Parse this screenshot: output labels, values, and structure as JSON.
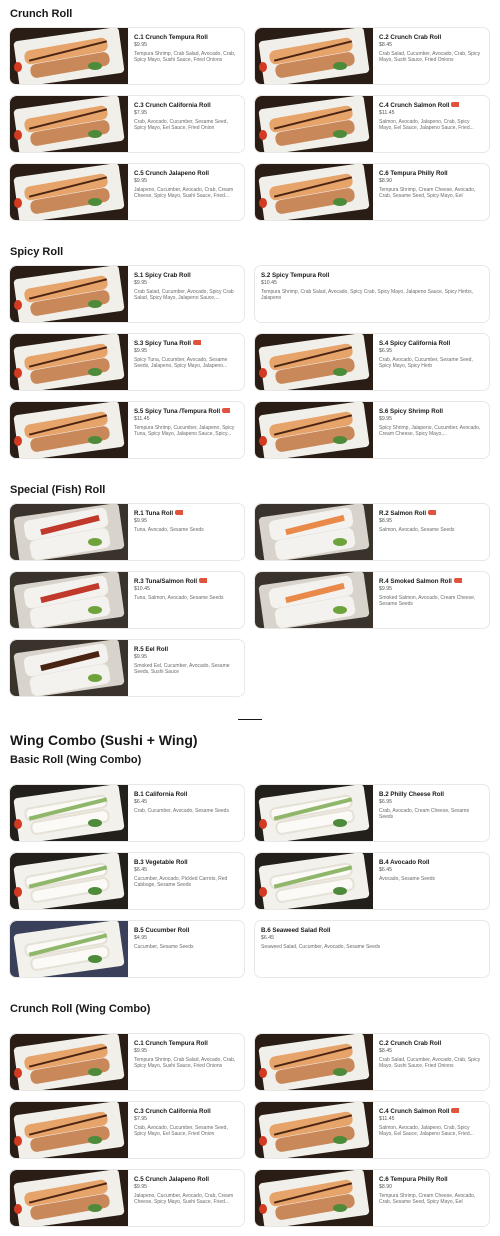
{
  "sections": {
    "crunch": {
      "title": "Crunch Roll"
    },
    "spicy": {
      "title": "Spicy Roll"
    },
    "special": {
      "title": "Special (Fish) Roll"
    },
    "wing": {
      "title": "Wing Combo (Sushi + Wing)"
    },
    "basic_wing": {
      "title": "Basic Roll (Wing Combo)"
    },
    "crunch_wing": {
      "title": "Crunch Roll (Wing Combo)"
    }
  },
  "items": [
    {
      "name": "C.1 Crunch Tempura Roll",
      "price": "$9.95",
      "desc": "Tempura Shrimp, Crab Salad, Avocado, Crab, Spicy Mayo, Sushi Sauce, Fried Onions"
    },
    {
      "name": "C.2 Crunch Crab Roll",
      "price": "$8.45",
      "desc": "Crab Salad, Cucumber, Avocado, Crab, Spicy Mayo, Sushi Sauce, Fried Onions"
    },
    {
      "name": "C.3 Crunch California Roll",
      "price": "$7.95",
      "desc": "Crab, Avocado, Cucumber, Sesame Seed, Spicy Mayo, Eel Sauce, Fried Onion"
    },
    {
      "name": "C.4 Crunch Salmon Roll",
      "price": "$11.45",
      "desc": "Salmon, Avocado, Jalapeno, Crab, Spicy Mayo, Eel Sauce, Jalapeno Sauce, Fried..."
    },
    {
      "name": "C.5 Crunch Jalapeno Roll",
      "price": "$9.95",
      "desc": "Jalapeno, Cucumber, Avocado, Crab, Cream Cheese, Spicy Mayo, Sushi Sauce, Fried..."
    },
    {
      "name": "C.6 Tempura Philly Roll",
      "price": "$8.90",
      "desc": "Tempura Shrimp, Cream Cheese, Avocado, Crab, Sesame Seed, Spicy Mayo, Eel Sauce,..."
    },
    {
      "name": "S.1 Spicy Crab Roll",
      "price": "$9.95",
      "desc": "Crab Salad, Cucumber, Avocado, Spicy Crab Salad, Spicy Mayo, Jalapeno Sauce,..."
    },
    {
      "name": "S.2 Spicy Tempura Roll",
      "price": "$10.45",
      "desc": "Tempura Shrimp, Crab Salad, Avocado, Spicy Crab, Spicy Mayo, Jalapeno Sauce, Spicy Herbs, Jalapeno"
    },
    {
      "name": "S.3 Spicy Tuna Roll",
      "price": "$9.95",
      "desc": "Spicy Tuna, Cucumber, Avocado, Sesame Seeds, Jalapeno, Spicy Mayo, Jalapeno..."
    },
    {
      "name": "S.4 Spicy California Roll",
      "price": "$6.95",
      "desc": "Crab, Avocado, Cucumber, Sesame Seed, Spicy Mayo, Spicy Herb"
    },
    {
      "name": "S.5 Spicy Tuna /Tempura Roll",
      "price": "$11.45",
      "desc": "Tempura Shrimp, Cucumber, Jalapeno, Spicy Tuna, Spicy Mayo, Jalapeno Sauce, Spicy..."
    },
    {
      "name": "S.6 Spicy Shrimp Roll",
      "price": "$9.95",
      "desc": "Spicy Shrimp, Jalapeno, Cucumber, Avocado, Cream Cheese, Spicy Mayo,..."
    },
    {
      "name": "R.1 Tuna Roll",
      "price": "$9.95",
      "desc": "Tuna, Avocado, Sesame Seeds"
    },
    {
      "name": "R.2 Salmon Roll",
      "price": "$8.95",
      "desc": "Salmon, Avocado, Sesame Seeds"
    },
    {
      "name": "R.3 Tuna/Salmon Roll",
      "price": "$10.45",
      "desc": "Tuna, Salmon, Avocado, Sesame Seeds"
    },
    {
      "name": "R.4 Smoked Salmon Roll",
      "price": "$9.95",
      "desc": "Smoked Salmon, Avocado, Cream Cheese, Sesame Seeds"
    },
    {
      "name": "R.5 Eel Roll",
      "price": "$9.95",
      "desc": "Smoked Eel, Cucumber, Avocado, Sesame Seeds, Sushi Sauce"
    },
    {
      "name": "B.1 California Roll",
      "price": "$6.45",
      "desc": "Crab, Cucumber, Avocado, Sesame Seeds"
    },
    {
      "name": "B.2 Philly Cheese Roll",
      "price": "$6.95",
      "desc": "Crab, Avocado, Cream Cheese, Sesame Seeds"
    },
    {
      "name": "B.3 Vegetable Roll",
      "price": "$6.45",
      "desc": "Cucumber, Avocado, Pickled Carrots, Red Cabbage, Sesame Seeds"
    },
    {
      "name": "B.4 Avocado Roll",
      "price": "$6.45",
      "desc": "Avocado, Sesame Seeds"
    },
    {
      "name": "B.5 Cucumber Roll",
      "price": "$4.95",
      "desc": "Cucumber, Sesame Seeds"
    },
    {
      "name": "B.6 Seaweed Salad Roll",
      "price": "$6.45",
      "desc": "Seaweed Salad, Cucumber, Avocado, Sesame Seeds"
    },
    {
      "name": "C.1 Crunch Tempura Roll",
      "price": "$9.95",
      "desc": "Tempura Shrimp, Crab Salad, Avocado, Crab, Spicy Mayo, Sushi Sauce, Fried Onions"
    },
    {
      "name": "C.2 Crunch Crab Roll",
      "price": "$8.45",
      "desc": "Crab Salad, Cucumber, Avocado, Crab, Spicy Mayo, Sushi Sauce, Fried Onions"
    },
    {
      "name": "C.3 Crunch California Roll",
      "price": "$7.95",
      "desc": "Crab, Avocado, Cucumber, Sesame Seed, Spicy Mayo, Eel Sauce, Fried Onion"
    },
    {
      "name": "C.4 Crunch Salmon Roll",
      "price": "$11.45",
      "desc": "Salmon, Avocado, Jalapeno, Crab, Spicy Mayo, Eel Sauce, Jalapeno Sauce, Fried..."
    },
    {
      "name": "C.5 Crunch Jalapeno Roll",
      "price": "$9.95",
      "desc": "Jalapeno, Cucumber, Avocado, Crab, Cream Cheese, Spicy Mayo, Sushi Sauce, Fried..."
    },
    {
      "name": "C.6 Tempura Philly Roll",
      "price": "$8.90",
      "desc": "Tempura Shrimp, Cream Cheese, Avocado, Crab, Sesame Seed, Spicy Mayo, Eel Sauce,..."
    }
  ],
  "icons": {
    "raw_fish": "raw-fish-icon"
  },
  "colors": {
    "raw_fish_badge": "#e0533d",
    "text": "#191919",
    "muted": "#6b6b6b",
    "border": "#e8e8e8"
  }
}
